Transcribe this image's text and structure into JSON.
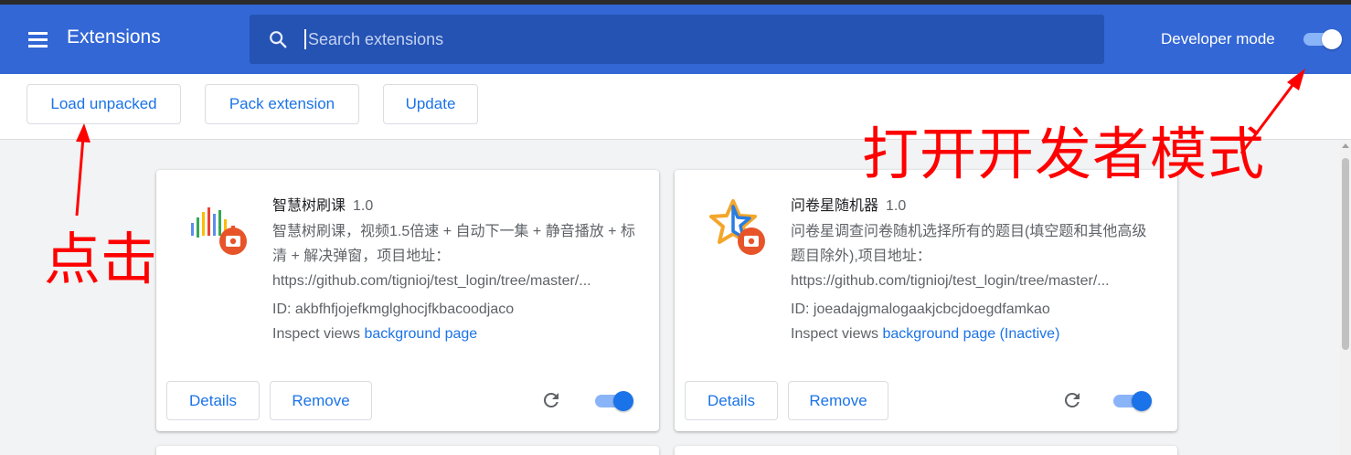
{
  "header": {
    "title": "Extensions",
    "search_placeholder": "Search extensions",
    "developer_mode_label": "Developer mode",
    "developer_mode_on": true
  },
  "toolbar": {
    "load_unpacked": "Load unpacked",
    "pack_extension": "Pack extension",
    "update": "Update"
  },
  "extensions": [
    {
      "name": "智慧树刷课",
      "version": "1.0",
      "description": "智慧树刷课，视频1.5倍速 + 自动下一集 + 静音播放 + 标清 + 解决弹窗，项目地址：",
      "url": "https://github.com/tignioj/test_login/tree/master/...",
      "id": "ID: akbfhfjojefkmglghocjfkbacoodjaco",
      "inspect_label": "Inspect views",
      "inspect_link": "background page",
      "details": "Details",
      "remove": "Remove",
      "enabled": true
    },
    {
      "name": "问卷星随机器",
      "version": "1.0",
      "description": "问卷星调查问卷随机选择所有的题目(填空题和其他高级题目除外),项目地址：",
      "url": "https://github.com/tignioj/test_login/tree/master/...",
      "id": "ID: joeadajgmalogaakjcbcjdoegdfamkao",
      "inspect_label": "Inspect views",
      "inspect_link": "background page (Inactive)",
      "details": "Details",
      "remove": "Remove",
      "enabled": true
    }
  ],
  "annotations": {
    "developer_mode_note": "打开开发者模式",
    "click_note": "点击",
    "color": "#ff0000"
  },
  "colors": {
    "header_bg": "#3367d6",
    "accent": "#1a73e8"
  }
}
